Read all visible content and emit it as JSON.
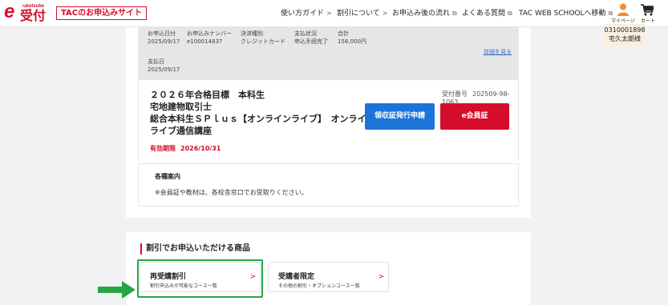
{
  "logo": {
    "mark": "e",
    "sub": "-uketsuke",
    "main": "受付"
  },
  "header": {
    "site_badge": "TACのお申込みサイト",
    "nav": [
      {
        "label": "使い方ガイド",
        "marker": ">"
      },
      {
        "label": "割引について",
        "marker": ">"
      },
      {
        "label": "お申込み後の流れ",
        "marker": "⧉"
      },
      {
        "label": "よくある質問",
        "marker": "⧉"
      },
      {
        "label": "TAC WEB SCHOOLへ移動",
        "marker": "⧉"
      }
    ],
    "mypage_label": "マイページ",
    "cart_label": "カート"
  },
  "user_tip": {
    "id": "0310001898",
    "name": "宅久太朗様"
  },
  "order_summary": {
    "columns": [
      {
        "label": "お申込日付",
        "value": "2025/09/17"
      },
      {
        "label": "お申込みナンバー",
        "value": "e100014837"
      },
      {
        "label": "決済種別",
        "value": "クレジットカード"
      },
      {
        "label": "支払状況",
        "value": "申込手続完了"
      },
      {
        "label": "合計",
        "value": "158,000円"
      }
    ],
    "payment_date_label": "支払日",
    "payment_date": "2025/09/17",
    "detail_link": "詳細を見る"
  },
  "item": {
    "title_line1": "２０２６年合格目標　本科生",
    "title_line2": "宅地建物取引士",
    "title_line3": "総合本科生ＳＰｌｕｓ【オンラインライブ】　オンライン",
    "title_line4": "ライブ通信講座",
    "expiry_label": "有効期限",
    "expiry_date": "2026/10/31",
    "receipt_label": "受付番号",
    "receipt_number": "202509-98-1063",
    "receipt_button": "領収証発行申請",
    "membership_button": "e会員証"
  },
  "notice": {
    "title": "各種案内",
    "text": "※会員証や教材は、各校舎窓口でお受取りください。"
  },
  "discount": {
    "title": "割引でお申込いただける商品",
    "options": [
      {
        "main": "再受講割引",
        "sub": "割引申込みが可能なコース一覧",
        "chevron": ">"
      },
      {
        "main": "受講者限定",
        "sub": "その他の割引・オプションコース一覧",
        "chevron": ">"
      }
    ]
  },
  "colors": {
    "brand_red": "#d40d2b",
    "button_blue": "#1c74d9",
    "highlight_green": "#27a545",
    "user_orange": "#f08c2e"
  }
}
